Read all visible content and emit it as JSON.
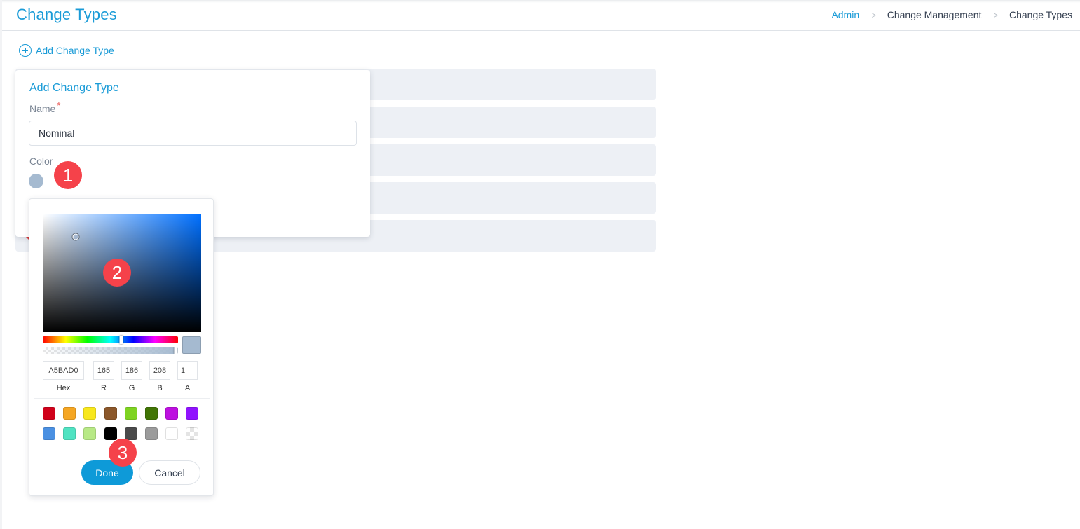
{
  "header": {
    "title": "Change Types",
    "breadcrumb": [
      {
        "label": "Admin",
        "link": true
      },
      {
        "label": "Change Management",
        "link": false
      },
      {
        "label": "Change Types",
        "link": false
      }
    ],
    "separator": ">"
  },
  "toolbar": {
    "add_label": "Add Change Type"
  },
  "list": {
    "row_count": 5
  },
  "form": {
    "title": "Add Change Type",
    "name_label": "Name",
    "required_mark": "*",
    "name_value": "Nominal",
    "color_label": "Color",
    "selected_color": "#A5BAD0"
  },
  "color_picker": {
    "hue_color": "#0070ff",
    "saturation_handle": {
      "s": 0.21,
      "v": 0.81
    },
    "hue_position": 0.58,
    "alpha_position": 1.0,
    "hex": "A5BAD0",
    "r": "165",
    "g": "186",
    "b": "208",
    "a": "1",
    "labels": {
      "hex": "Hex",
      "r": "R",
      "g": "G",
      "b": "B",
      "a": "A"
    },
    "presets": [
      "#D0021B",
      "#F5A623",
      "#F8E71C",
      "#8B572A",
      "#7ED321",
      "#417505",
      "#BD10E0",
      "#9013FE",
      "#4A90E2",
      "#50E3C2",
      "#B8E986",
      "#000000",
      "#4A4A4A",
      "#9B9B9B",
      "#FFFFFF",
      "transparent"
    ],
    "done_label": "Done",
    "cancel_label": "Cancel"
  },
  "annotations": [
    "1",
    "2",
    "3"
  ]
}
